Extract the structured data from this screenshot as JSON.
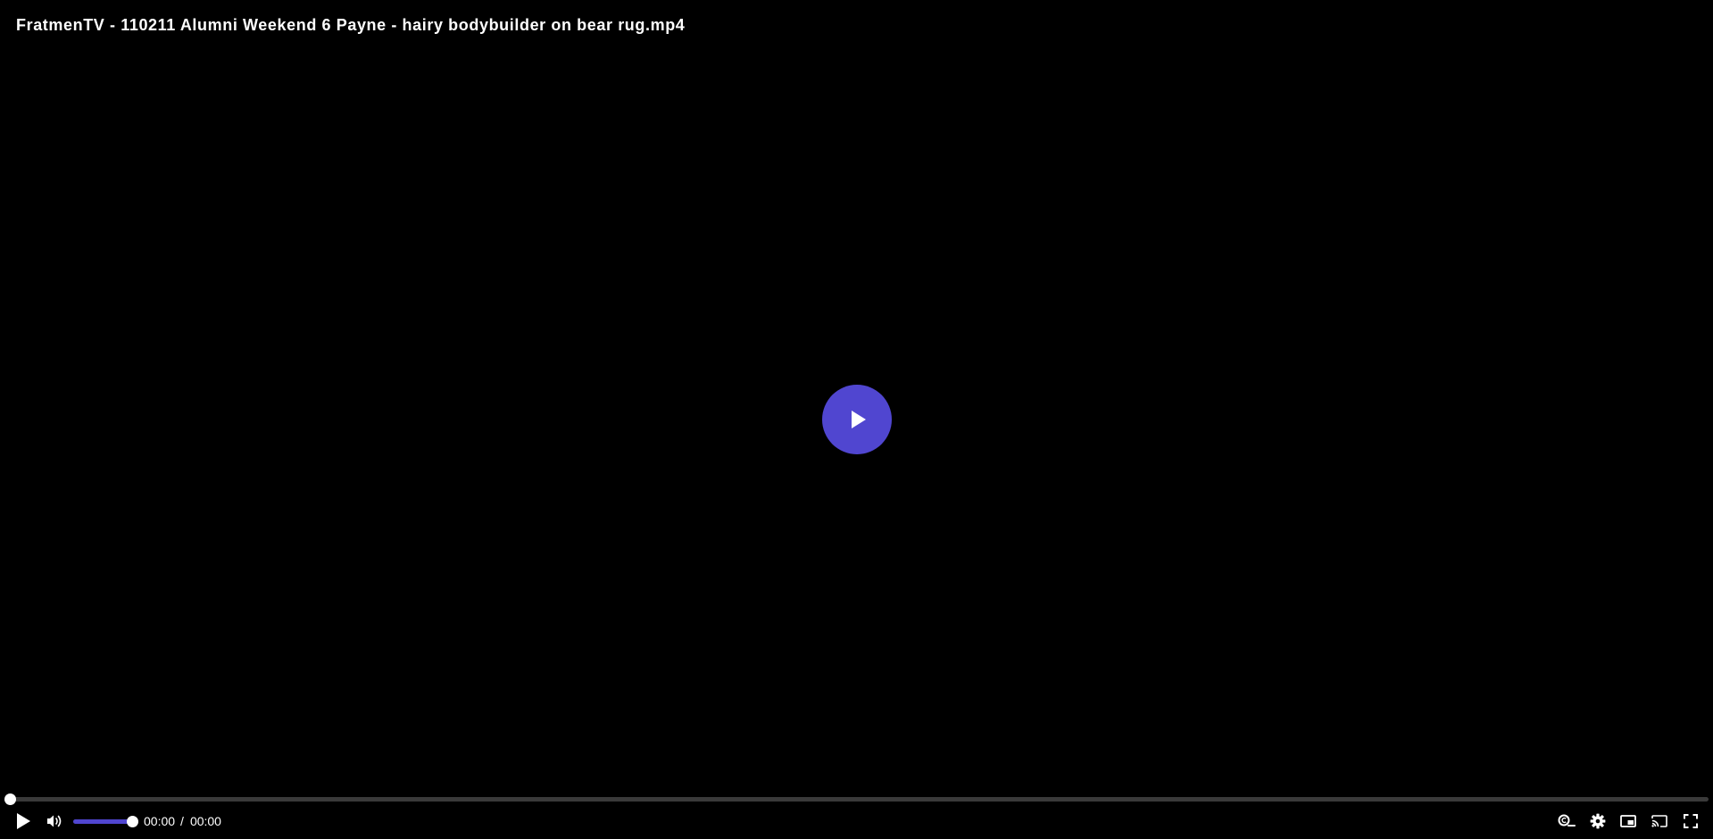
{
  "video": {
    "title": "FratmenTV - 110211 Alumni Weekend 6 Payne - hairy bodybuilder on bear rug.mp4"
  },
  "playback": {
    "current_time": "00:00",
    "separator": "/",
    "duration": "00:00",
    "progress_fraction": 0,
    "volume_fraction": 1
  },
  "colors": {
    "accent": "#5046d0",
    "background": "#000000",
    "track": "#3a3a3a",
    "text": "#ffffff"
  },
  "icons": {
    "big_play": "play-icon",
    "play": "play-icon",
    "volume": "volume-icon",
    "captions": "captions-icon",
    "settings": "gear-icon",
    "pip": "picture-in-picture-icon",
    "cast": "cast-icon",
    "fullscreen": "fullscreen-icon"
  }
}
